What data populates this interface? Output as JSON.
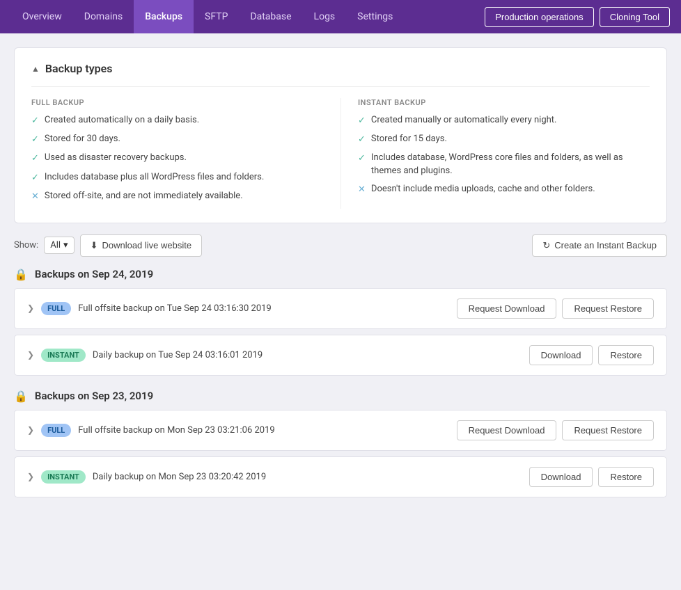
{
  "nav": {
    "items": [
      {
        "label": "Overview",
        "active": false
      },
      {
        "label": "Domains",
        "active": false
      },
      {
        "label": "Backups",
        "active": true
      },
      {
        "label": "SFTP",
        "active": false
      },
      {
        "label": "Database",
        "active": false
      },
      {
        "label": "Logs",
        "active": false
      },
      {
        "label": "Settings",
        "active": false
      }
    ],
    "production_btn": "Production operations",
    "cloning_btn": "Cloning Tool"
  },
  "backup_types": {
    "title": "Backup types",
    "full": {
      "label": "FULL BACKUP",
      "features": [
        {
          "type": "check",
          "text": "Created automatically on a daily basis."
        },
        {
          "type": "check",
          "text": "Stored for 30 days."
        },
        {
          "type": "check",
          "text": "Used as disaster recovery backups."
        },
        {
          "type": "check",
          "text": "Includes database plus all WordPress files and folders."
        },
        {
          "type": "x",
          "text": "Stored off-site, and are not immediately available."
        }
      ]
    },
    "instant": {
      "label": "INSTANT BACKUP",
      "features": [
        {
          "type": "check",
          "text": "Created manually or automatically every night."
        },
        {
          "type": "check",
          "text": "Stored for 15 days."
        },
        {
          "type": "check",
          "text": "Includes database, WordPress core files and folders, as well as themes and plugins."
        },
        {
          "type": "x",
          "text": "Doesn't include media uploads, cache and other folders."
        }
      ]
    }
  },
  "filter": {
    "show_label": "Show:",
    "show_value": "All",
    "download_live_label": "Download live website",
    "create_instant_label": "Create an Instant Backup"
  },
  "backup_groups": [
    {
      "date": "Backups on Sep 24, 2019",
      "items": [
        {
          "type": "full",
          "badge": "FULL",
          "description": "Full offsite backup on Tue Sep 24 03:16:30 2019",
          "actions": [
            "Request Download",
            "Request Restore"
          ]
        },
        {
          "type": "instant",
          "badge": "INSTANT",
          "description": "Daily backup on Tue Sep 24 03:16:01 2019",
          "actions": [
            "Download",
            "Restore"
          ]
        }
      ]
    },
    {
      "date": "Backups on Sep 23, 2019",
      "items": [
        {
          "type": "full",
          "badge": "FULL",
          "description": "Full offsite backup on Mon Sep 23 03:21:06 2019",
          "actions": [
            "Request Download",
            "Request Restore"
          ]
        },
        {
          "type": "instant",
          "badge": "INSTANT",
          "description": "Daily backup on Mon Sep 23 03:20:42 2019",
          "actions": [
            "Download",
            "Restore"
          ]
        }
      ]
    }
  ]
}
